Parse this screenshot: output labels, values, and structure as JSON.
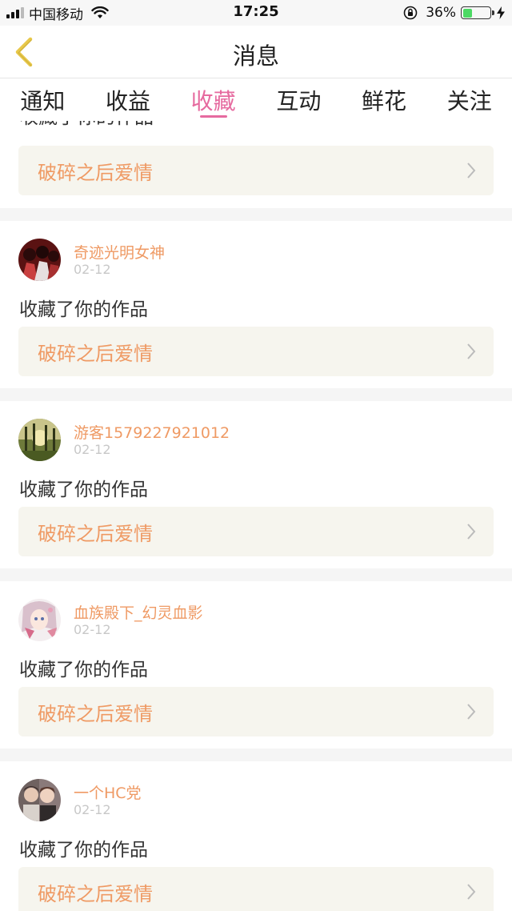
{
  "status_bar": {
    "carrier": "中国移动",
    "time": "17:25",
    "battery_percent": "36%",
    "battery_level": 0.36
  },
  "nav": {
    "title": "消息"
  },
  "tabs": [
    {
      "label": "通知",
      "active": false
    },
    {
      "label": "收益",
      "active": false
    },
    {
      "label": "收藏",
      "active": true
    },
    {
      "label": "互动",
      "active": false
    },
    {
      "label": "鲜花",
      "active": false
    },
    {
      "label": "关注",
      "active": false
    }
  ],
  "top_partial": {
    "action_text": "收藏了你的作品",
    "work_title": "破碎之后爱情"
  },
  "items": [
    {
      "username": "奇迹光明女神",
      "date": "02-12",
      "action_text": "收藏了你的作品",
      "work_title": "破碎之后爱情",
      "avatar_icon": "avatar-red-girls"
    },
    {
      "username": "游客1579227921012",
      "date": "02-12",
      "action_text": "收藏了你的作品",
      "work_title": "破碎之后爱情",
      "avatar_icon": "avatar-forest"
    },
    {
      "username": "血族殿下_幻灵血影",
      "date": "02-12",
      "action_text": "收藏了你的作品",
      "work_title": "破碎之后爱情",
      "avatar_icon": "avatar-anime-girl"
    },
    {
      "username": "一个HC党",
      "date": "02-12",
      "action_text": "收藏了你的作品",
      "work_title": "破碎之后爱情",
      "avatar_icon": "avatar-two-people"
    }
  ],
  "colors": {
    "accent_pink": "#e66a9f",
    "username_orange": "#ef9a64",
    "work_bg": "#f6f5ee",
    "back_arrow": "#e8c84a"
  }
}
